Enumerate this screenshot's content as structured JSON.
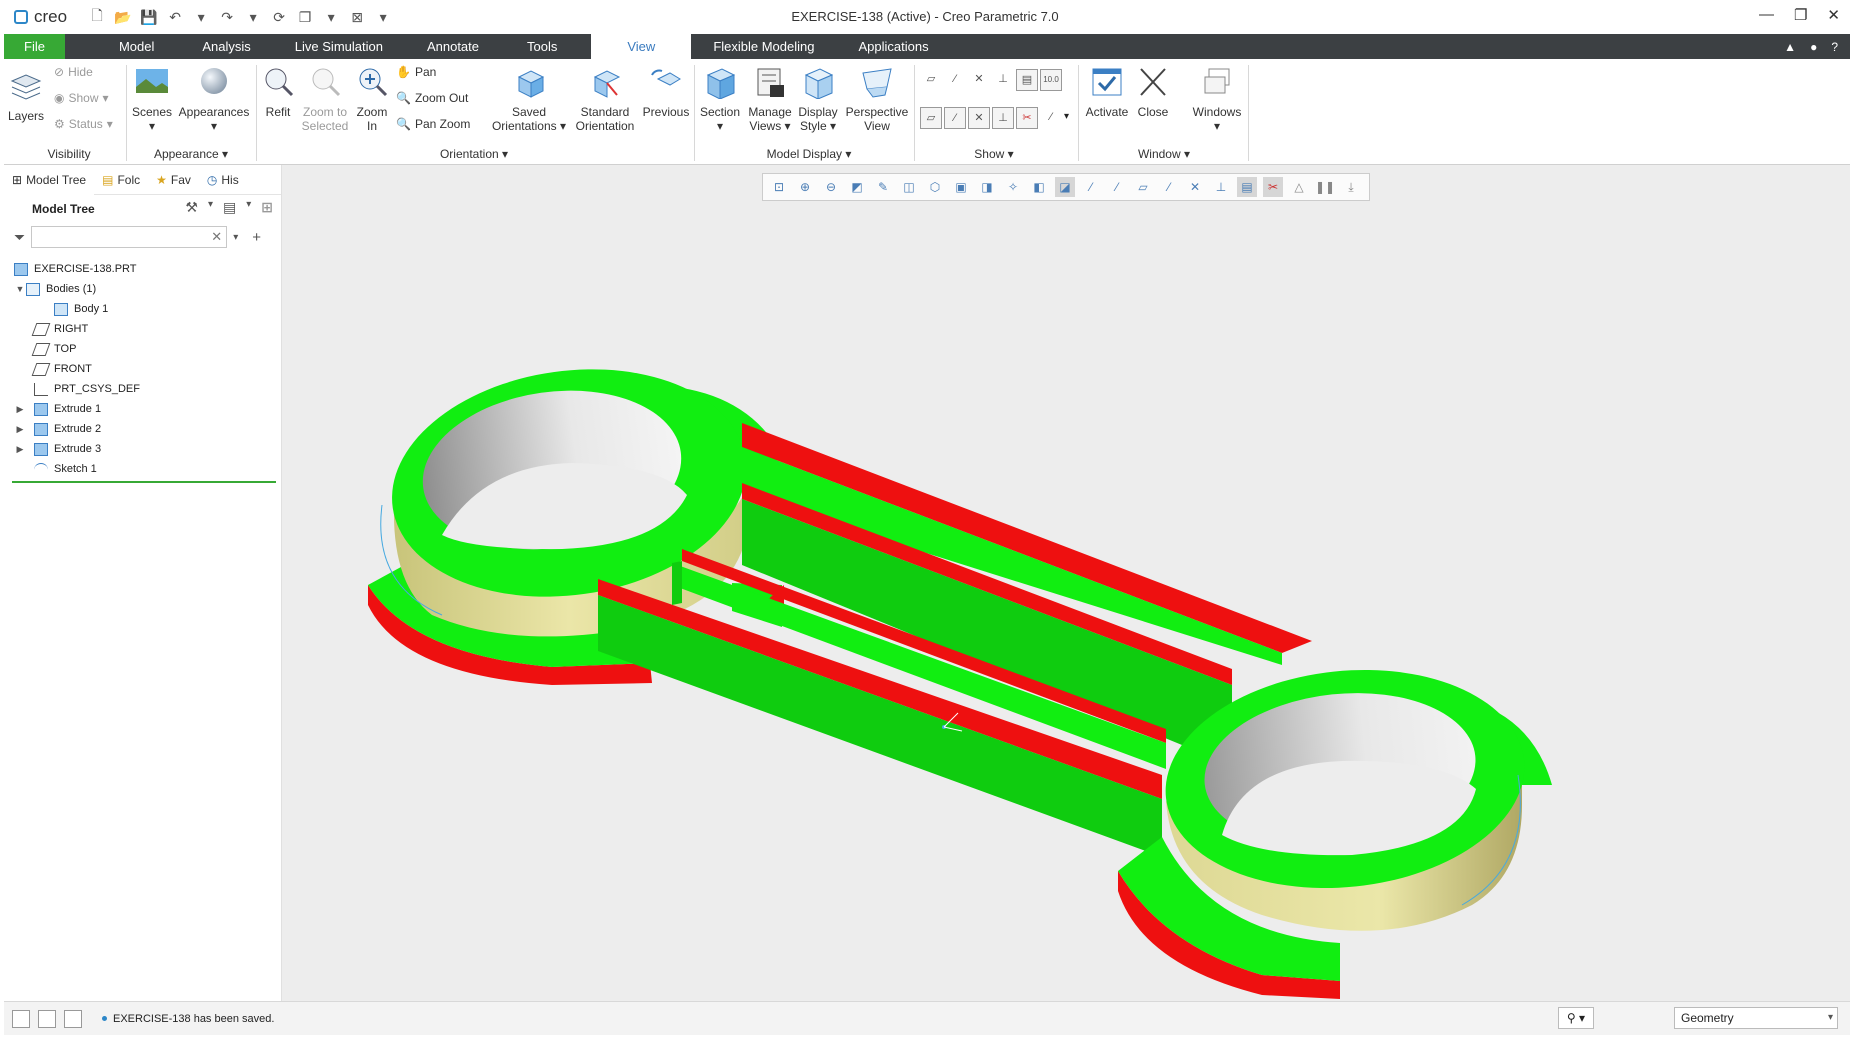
{
  "titlebar": {
    "app_name": "creo",
    "window_title": "EXERCISE-138 (Active) - Creo Parametric 7.0"
  },
  "tabs": [
    {
      "label": "File"
    },
    {
      "label": "Model"
    },
    {
      "label": "Analysis"
    },
    {
      "label": "Live Simulation"
    },
    {
      "label": "Annotate"
    },
    {
      "label": "Tools"
    },
    {
      "label": "View"
    },
    {
      "label": "Flexible Modeling"
    },
    {
      "label": "Applications"
    }
  ],
  "ribbon": {
    "visibility": {
      "label": "Visibility",
      "layers": "Layers",
      "hide": "Hide",
      "show": "Show",
      "status": "Status"
    },
    "appearance": {
      "label": "Appearance",
      "scenes": "Scenes",
      "appearances": "Appearances"
    },
    "orientation": {
      "label": "Orientation",
      "refit": "Refit",
      "zoom_to_selected": "Zoom to",
      "zoom_to_selected2": "Selected",
      "zoom_in": "Zoom",
      "zoom_in2": "In",
      "pan": "Pan",
      "zoom_out": "Zoom Out",
      "pan_zoom": "Pan Zoom",
      "saved": "Saved",
      "saved2": "Orientations",
      "standard": "Standard",
      "standard2": "Orientation",
      "previous": "Previous"
    },
    "model_display": {
      "label": "Model Display",
      "section": "Section",
      "manage": "Manage",
      "manage2": "Views",
      "display": "Display",
      "display2": "Style",
      "perspective": "Perspective",
      "perspective2": "View"
    },
    "show": {
      "label": "Show",
      "value": "10.0"
    },
    "window": {
      "label": "Window",
      "activate": "Activate",
      "close": "Close",
      "windows": "Windows"
    }
  },
  "panel": {
    "tabs": [
      {
        "label": "Model Tree"
      },
      {
        "label": "Folc"
      },
      {
        "label": "Fav"
      },
      {
        "label": "His"
      }
    ],
    "header": "Model Tree",
    "search_placeholder": "",
    "tree": [
      {
        "label": "EXERCISE-138.PRT"
      },
      {
        "label": "Bodies (1)"
      },
      {
        "label": "Body 1"
      },
      {
        "label": "RIGHT"
      },
      {
        "label": "TOP"
      },
      {
        "label": "FRONT"
      },
      {
        "label": "PRT_CSYS_DEF"
      },
      {
        "label": "Extrude 1"
      },
      {
        "label": "Extrude 2"
      },
      {
        "label": "Extrude 3"
      },
      {
        "label": "Sketch 1"
      }
    ]
  },
  "status": {
    "message": "EXERCISE-138 has been saved.",
    "filter_value": "Geometry"
  },
  "colors": {
    "accent_green": "#37a935",
    "tab_bar": "#3c4043",
    "active_tab_text": "#3a7bbf",
    "model_green": "#11ee11",
    "model_red": "#ee0e0e",
    "model_tan": "#d8d49a",
    "graphics_bg": "#ededed"
  }
}
